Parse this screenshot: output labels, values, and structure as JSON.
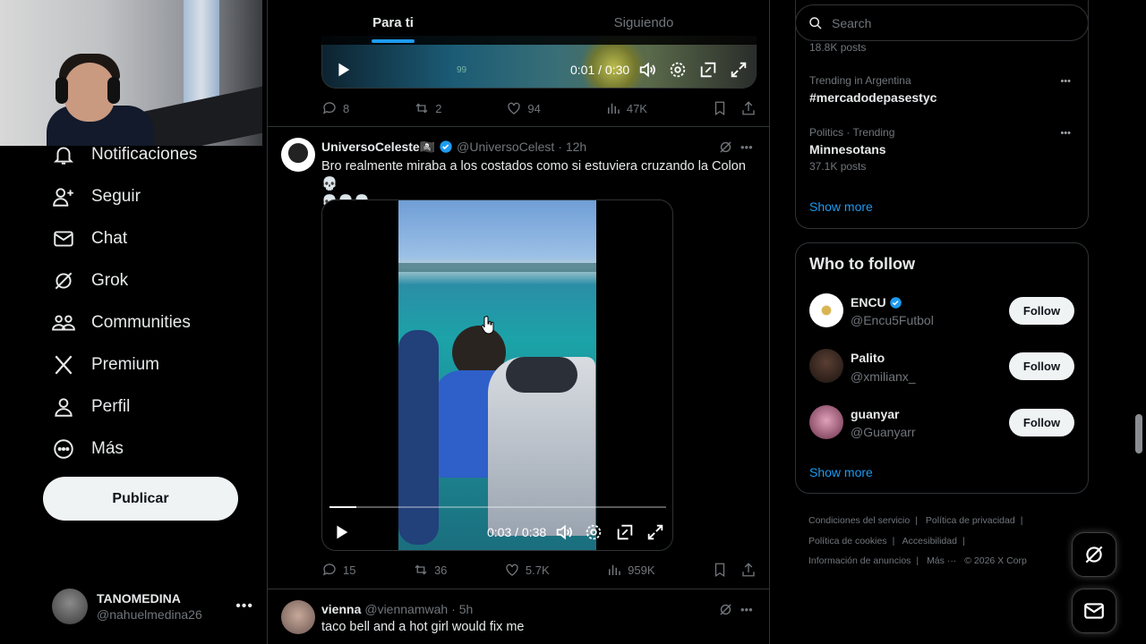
{
  "tabs": {
    "for_you": "Para ti",
    "following": "Siguiendo"
  },
  "nav": {
    "notifications": "Notificaciones",
    "follow": "Seguir",
    "chat": "Chat",
    "grok": "Grok",
    "communities": "Communities",
    "premium": "Premium",
    "profile": "Perfil",
    "more": "Más",
    "publish": "Publicar"
  },
  "account": {
    "name": "TANOMEDINA",
    "handle": "@nahuelmedina26"
  },
  "top_post": {
    "video_time": "0:01 / 0:30",
    "overlay_count": "99",
    "replies": "8",
    "reposts": "2",
    "likes": "94",
    "views": "47K"
  },
  "post1": {
    "author": "UniversoCeleste🏴‍☠️",
    "handle": "@UniversoCelest",
    "time": "· 12h",
    "text": "Bro realmente miraba a los costados como si estuviera cruzando la Colon 💀",
    "text2": "💀💀💀",
    "video_time": "0:03 / 0:38",
    "video_progress": 0.08,
    "replies": "15",
    "reposts": "36",
    "likes": "5.7K",
    "views": "959K"
  },
  "post2": {
    "author": "vienna",
    "handle": "@viennamwah",
    "time": "· 5h",
    "text": "taco bell and a hot girl would fix me"
  },
  "search": {
    "placeholder": "Search"
  },
  "trends": {
    "top_posts": "18.8K posts",
    "items": [
      {
        "meta": "Trending in Argentina",
        "title": "#mercadodepasestyc",
        "posts": ""
      },
      {
        "meta": "Politics · Trending",
        "title": "Minnesotans",
        "posts": "37.1K posts"
      }
    ],
    "show_more": "Show more"
  },
  "who_to_follow": {
    "title": "Who to follow",
    "users": [
      {
        "name": "ENCU",
        "handle": "@Encu5Futbol",
        "verified": true
      },
      {
        "name": "Palito",
        "handle": "@xmilianx_",
        "verified": false
      },
      {
        "name": "guanyar",
        "handle": "@Guanyarr",
        "verified": false
      }
    ],
    "follow_label": "Follow",
    "show_more": "Show more"
  },
  "footer": {
    "terms": "Condiciones del servicio",
    "privacy": "Política de privacidad",
    "cookies": "Política de cookies",
    "accessibility": "Accesibilidad",
    "ads": "Información de anuncios",
    "more": "Más ···",
    "copyright": "© 2026 X Corp"
  },
  "colors": {
    "accent": "#1d9bf0",
    "background": "#000000",
    "border": "#2f3336",
    "muted": "#71767b"
  }
}
